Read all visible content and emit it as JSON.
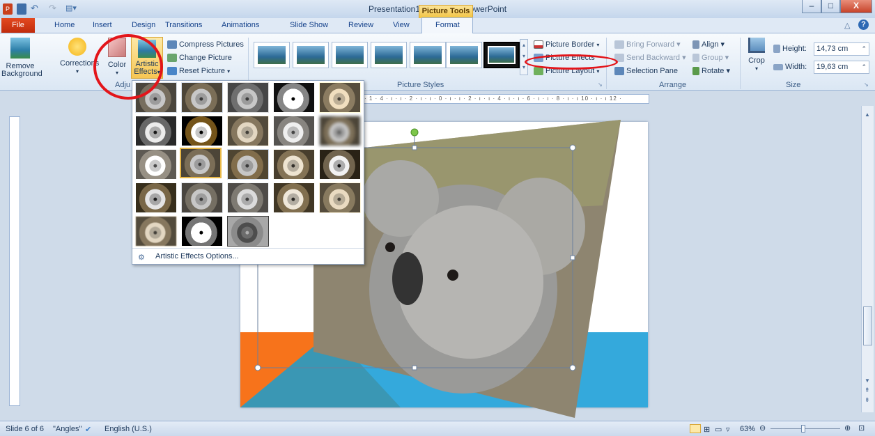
{
  "window": {
    "title": "Presentation1 - Microsoft PowerPoint",
    "contextual_tab": "Picture Tools",
    "minimize": "–",
    "maximize": "□",
    "close": "X"
  },
  "tabs": [
    "Home",
    "Insert",
    "Design",
    "Transitions",
    "Animations",
    "Slide Show",
    "Review",
    "View",
    "Format"
  ],
  "file_tab": "File",
  "ribbon": {
    "adjust": {
      "remove_background_1": "Remove",
      "remove_background_2": "Background",
      "corrections": "Corrections",
      "color": "Color",
      "artistic_effects_1": "Artistic",
      "artistic_effects_2": "Effects",
      "compress": "Compress Pictures",
      "change": "Change Picture",
      "reset": "Reset Picture",
      "group_label": "Adju"
    },
    "picture_styles": {
      "group_label": "Picture Styles"
    },
    "style_effects": {
      "border": "Picture Border",
      "effects": "Picture Effects",
      "layout": "Picture Layout"
    },
    "arrange": {
      "bring_forward": "Bring Forward",
      "send_backward": "Send Backward",
      "selection_pane": "Selection Pane",
      "align": "Align",
      "group": "Group",
      "rotate": "Rotate",
      "group_label": "Arrange"
    },
    "size": {
      "crop": "Crop",
      "height_label": "Height:",
      "height_value": "14,73 cm",
      "width_label": "Width:",
      "width_value": "19,63 cm",
      "group_label": "Size"
    }
  },
  "ruler_text": "· 1 · 4 · ı · ı · 2 · ı · ı · 0 · ı · ı · 2 · ı · ı · 4 · ı · ı · 6 · ı · ı · 8 · ı · ı 10 · ı · ı 12 ·",
  "gallery": {
    "options_label": "Artistic Effects Options..."
  },
  "statusbar": {
    "slide": "Slide 6 of 6",
    "theme": "\"Angles\"",
    "language": "English (U.S.)",
    "zoom": "63%"
  },
  "colors": {
    "orange": "#f7731b",
    "blue": "#34a9dc",
    "teal": "#3a97b4",
    "annotation_red": "#e3151a"
  }
}
